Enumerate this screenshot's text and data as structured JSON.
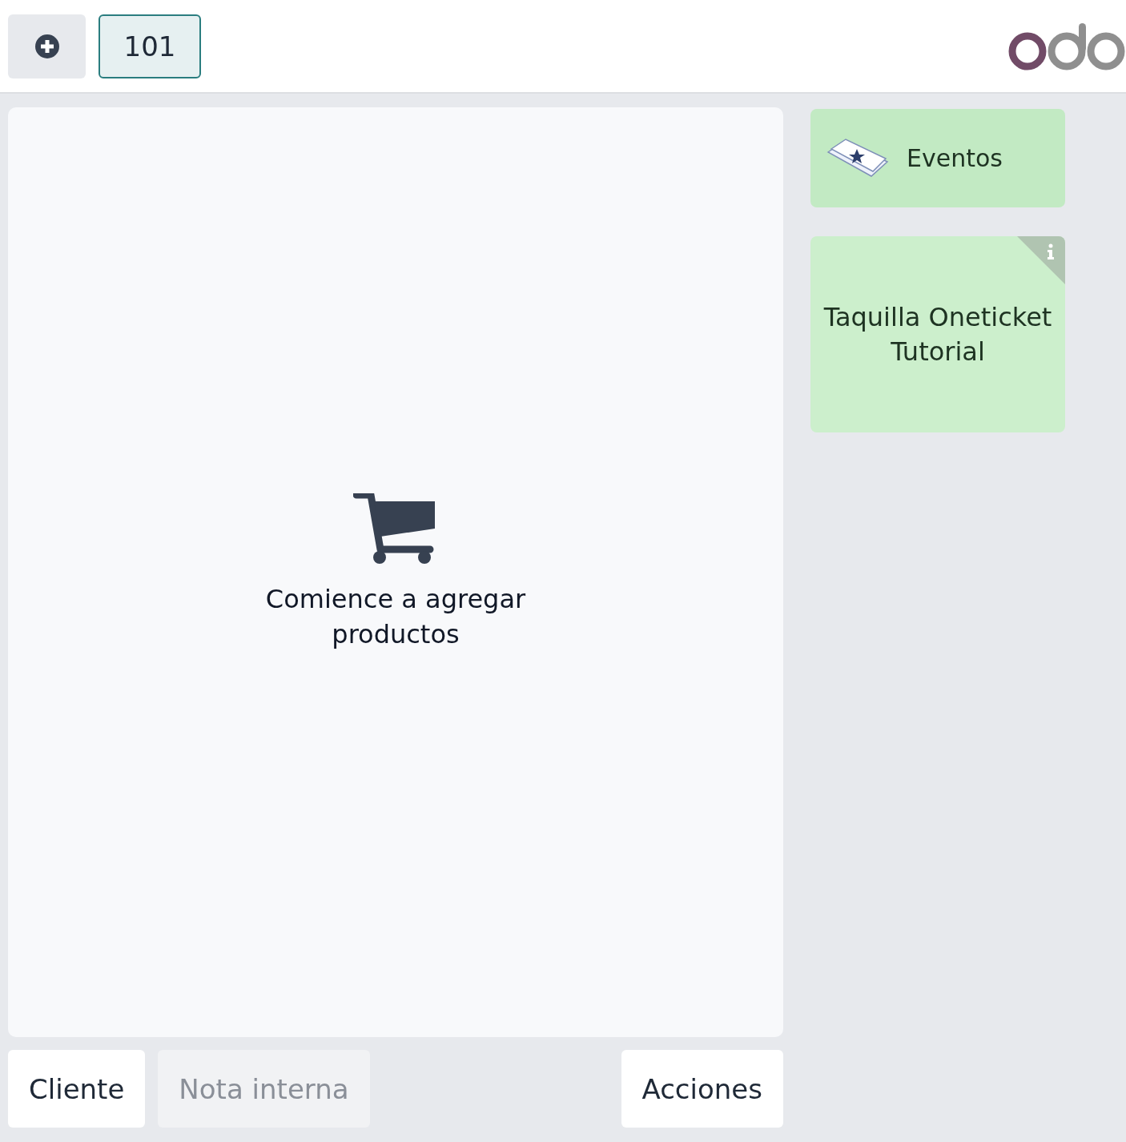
{
  "header": {
    "new_order_button": {
      "kind": "plus"
    },
    "order_tabs": [
      {
        "label": "101",
        "selected": true
      }
    ]
  },
  "order": {
    "empty_message": "Comience a agregar productos"
  },
  "actions": [
    {
      "label": "Cliente",
      "disabled": false
    },
    {
      "label": "Nota interna",
      "disabled": true
    },
    {
      "label": "Acciones",
      "disabled": false
    }
  ],
  "categories": [
    {
      "label": "Eventos"
    }
  ],
  "products": [
    {
      "name": "Taquilla Oneticket Tutorial",
      "info": true
    }
  ]
}
